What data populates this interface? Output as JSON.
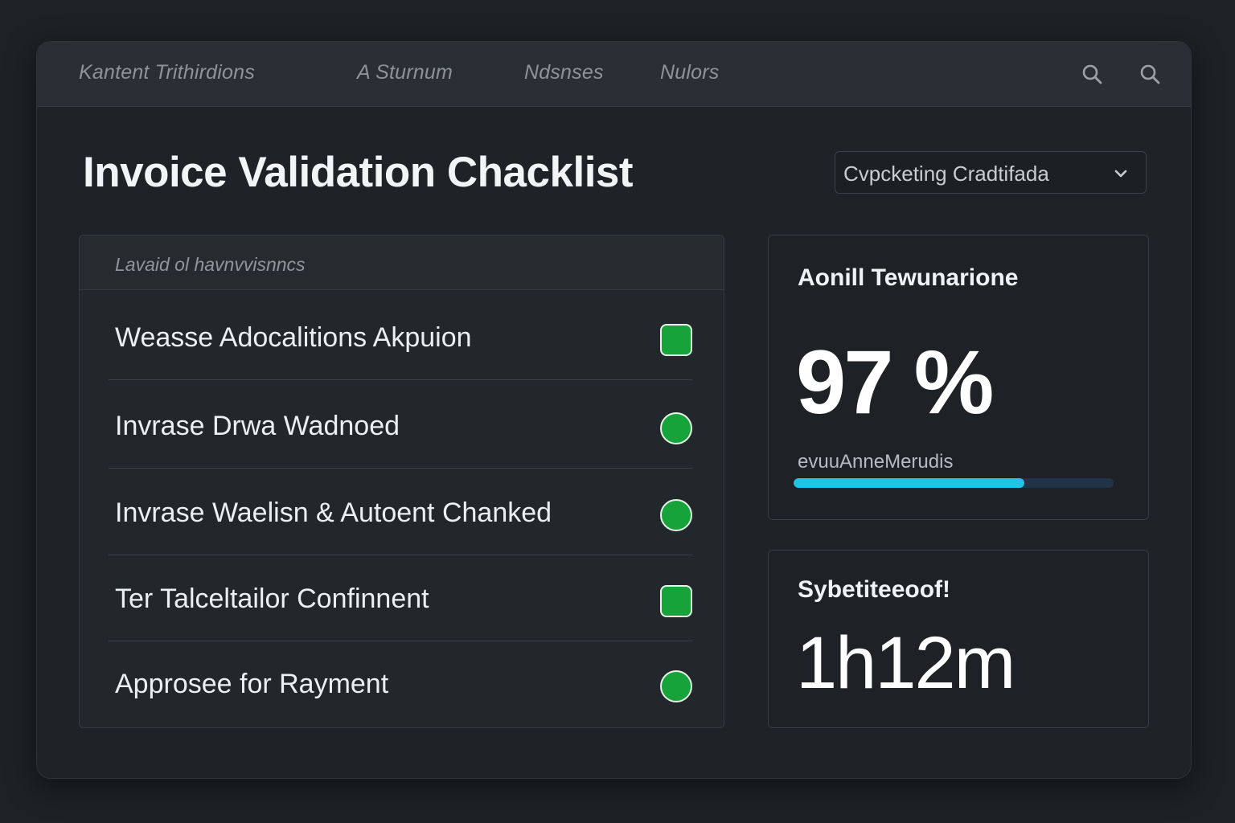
{
  "nav": {
    "items": [
      {
        "label": "Kantent Trithirdions"
      },
      {
        "label": "A Sturnum"
      },
      {
        "label": "Ndsnses"
      },
      {
        "label": "Nulors"
      }
    ],
    "icons": [
      "search-icon",
      "search-icon"
    ]
  },
  "page": {
    "title": "Invoice Validation Chacklist"
  },
  "dropdown": {
    "selected": "Cvpcketing Cradtifada",
    "icon": "chevron-down-icon"
  },
  "checklist": {
    "header": "Lavaid ol havnvvisnncs",
    "items": [
      {
        "label": "Weasse Adocalitions Akpuion",
        "status": "complete",
        "shape": "square"
      },
      {
        "label": "Invrase Drwa Wadnoed",
        "status": "complete",
        "shape": "circle"
      },
      {
        "label": "Invrase Waelisn & Autoent Chanked",
        "status": "complete",
        "shape": "circle"
      },
      {
        "label": "Ter Talceltailor Confinnent",
        "status": "complete",
        "shape": "square"
      },
      {
        "label": "Approsee for Rayment",
        "status": "complete",
        "shape": "circle"
      }
    ]
  },
  "accuracy_card": {
    "title": "Aonill Tewunarione",
    "value": "97 %",
    "progress_label": "evuuAnneMerudis",
    "progress_fraction": 0.72
  },
  "time_card": {
    "title": "Sybetiteeoof!",
    "value": "1h12m"
  },
  "colors": {
    "status_complete": "#16a33a",
    "progress_fill": "#22c3e8",
    "progress_track": "#213447",
    "background": "#1d2226",
    "panel": "#22272b"
  }
}
